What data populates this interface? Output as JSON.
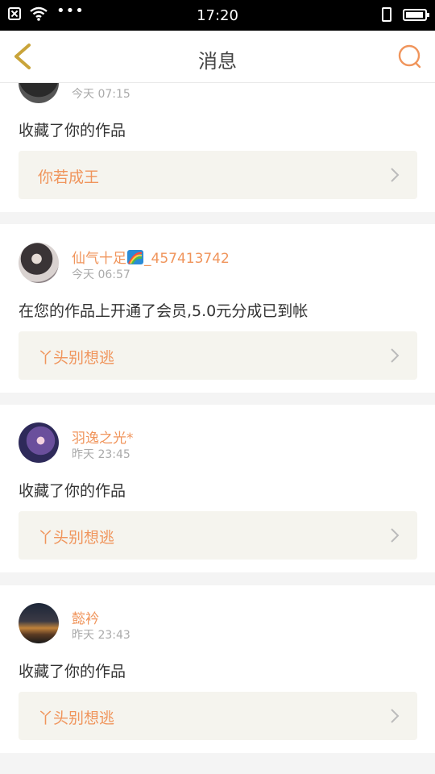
{
  "status_bar": {
    "time": "17:20"
  },
  "header": {
    "title": "消息"
  },
  "messages": [
    {
      "name": "",
      "time": "今天 07:15",
      "text": "收藏了你的作品",
      "work": "你若成王"
    },
    {
      "name_prefix": "仙气十足",
      "name_suffix": "_457413742",
      "time": "今天 06:57",
      "text": "在您的作品上开通了会员,5.0元分成已到帐",
      "work": "丫头别想逃"
    },
    {
      "name": "羽逸之光*",
      "time": "昨天 23:45",
      "text": "收藏了你的作品",
      "work": "丫头别想逃"
    },
    {
      "name": "懿衿",
      "time": "昨天 23:43",
      "text": "收藏了你的作品",
      "work": "丫头别想逃"
    }
  ],
  "colors": {
    "accent": "#f0955c",
    "back_icon": "#c9a43a",
    "work_bg": "#f5f4ee"
  }
}
